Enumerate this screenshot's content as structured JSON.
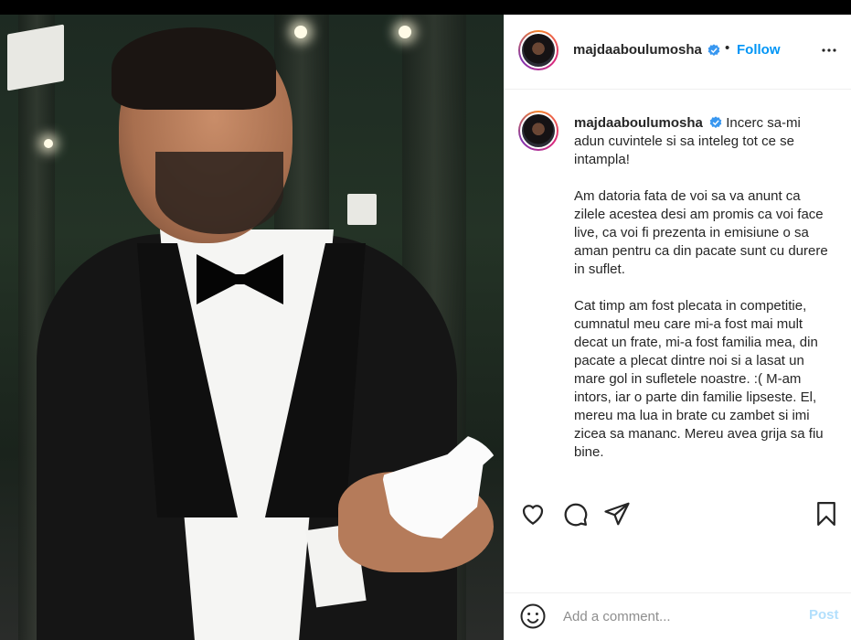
{
  "post": {
    "username": "majdaaboulumosha",
    "verified": true,
    "separator": "•",
    "follow_label": "Follow",
    "more_icon": "more-options-icon",
    "caption_paragraphs": [
      "Incerc sa-mi adun cuvintele si sa inteleg tot ce se intampla!",
      "Am datoria fata de voi sa va anunt ca zilele acestea desi am promis ca voi face live, ca voi fi prezenta in emisiune o sa aman pentru ca din pacate sunt cu durere in suflet.",
      "Cat timp am fost plecata in competitie, cumnatul meu care mi-a fost mai mult decat un frate, mi-a fost familia mea, din pacate a plecat dintre noi si a lasat un mare gol in sufletele noastre. :( M-am intors, iar o parte din familie lipseste. El, mereu ma lua in brate cu zambet si imi zicea sa mananc. Mereu avea grija sa fiu bine."
    ]
  },
  "actions": {
    "like_icon": "heart-icon",
    "comment_icon": "comment-icon",
    "share_icon": "share-icon",
    "save_icon": "bookmark-icon"
  },
  "comment_box": {
    "placeholder": "Add a comment...",
    "value": "",
    "post_label": "Post",
    "emoji_icon": "emoji-icon"
  },
  "colors": {
    "accent": "#0095f6",
    "post_disabled": "#b2dffc",
    "text": "#262626",
    "muted": "#8e8e8e",
    "divider": "#efefef"
  }
}
